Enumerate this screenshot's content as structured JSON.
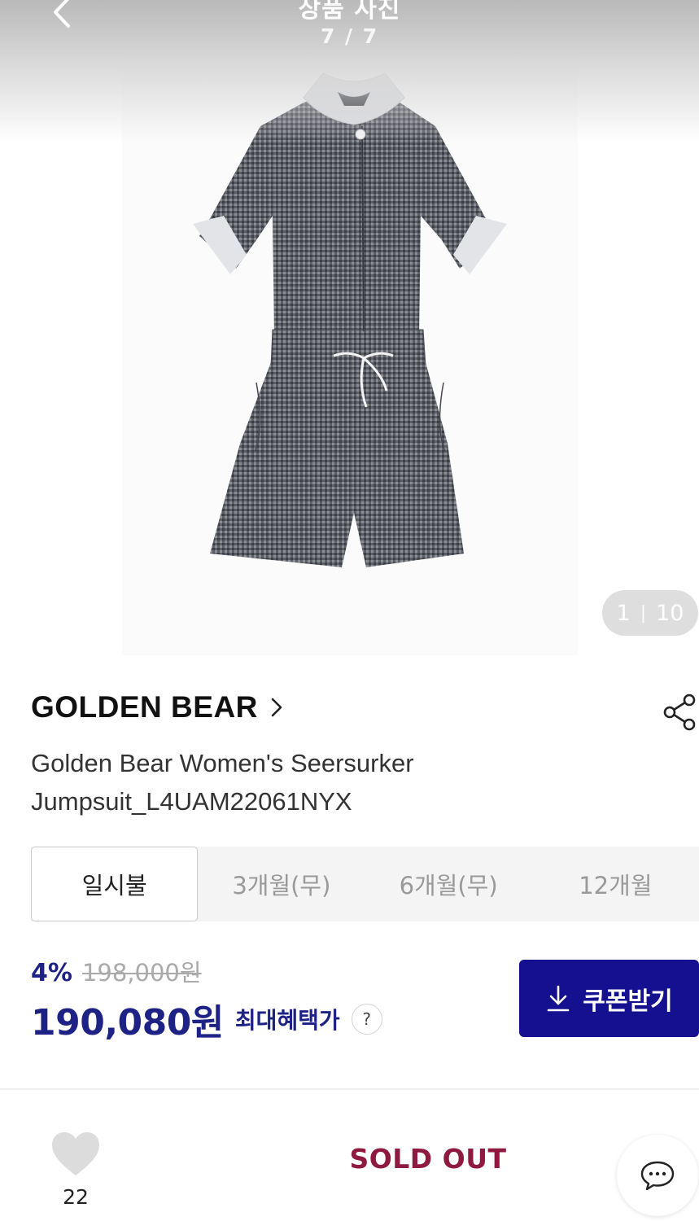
{
  "header": {
    "title": "상품 사진",
    "counter": "7 / 7"
  },
  "gallery": {
    "current": "1",
    "total": "10"
  },
  "product": {
    "brand": "GOLDEN BEAR",
    "name_line1": "Golden Bear Women's Seersurker",
    "name_line2": "Jumpsuit_L4UAM22061NYX"
  },
  "installment_tabs": [
    {
      "label": "일시불",
      "active": true
    },
    {
      "label": "3개월(무)",
      "active": false
    },
    {
      "label": "6개월(무)",
      "active": false
    },
    {
      "label": "12개월",
      "active": false
    }
  ],
  "price": {
    "discount_rate": "4%",
    "original": "198,000원",
    "sale": "190,080원",
    "benefit_label": "최대혜택가",
    "help_glyph": "?"
  },
  "coupon": {
    "label": "쿠폰받기"
  },
  "bottom_bar": {
    "like_count": "22",
    "status": "SOLD OUT"
  },
  "colors": {
    "accent_navy": "#14108f",
    "price_navy": "#1e2285",
    "soldout_red": "#8e1a3f"
  },
  "icons": [
    "back-arrow-icon",
    "chevron-right-icon",
    "share-icon",
    "download-icon",
    "heart-icon",
    "chat-bubble-icon"
  ]
}
